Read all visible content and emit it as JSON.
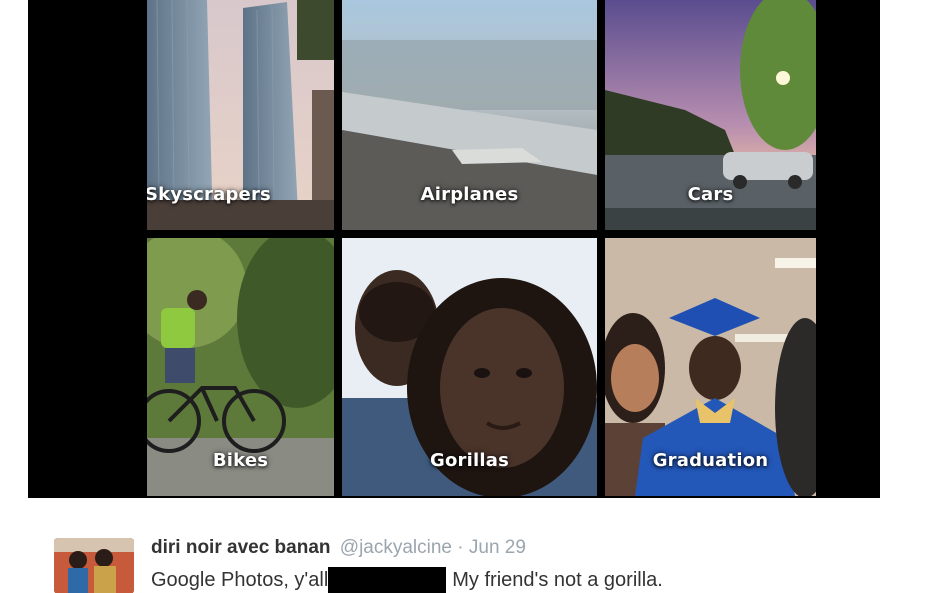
{
  "photo_grid": {
    "tiles": [
      {
        "label": "Skyscrapers"
      },
      {
        "label": "Airplanes"
      },
      {
        "label": "Cars"
      },
      {
        "label": "Bikes"
      },
      {
        "label": "Gorillas"
      },
      {
        "label": "Graduation"
      }
    ]
  },
  "tweet": {
    "author_name": "diri noir avec banan",
    "handle": "@jackyalcine",
    "separator": "·",
    "date": "Jun 29",
    "text_before": "Google Photos, y'all",
    "text_after": "My friend's not a gorilla."
  }
}
